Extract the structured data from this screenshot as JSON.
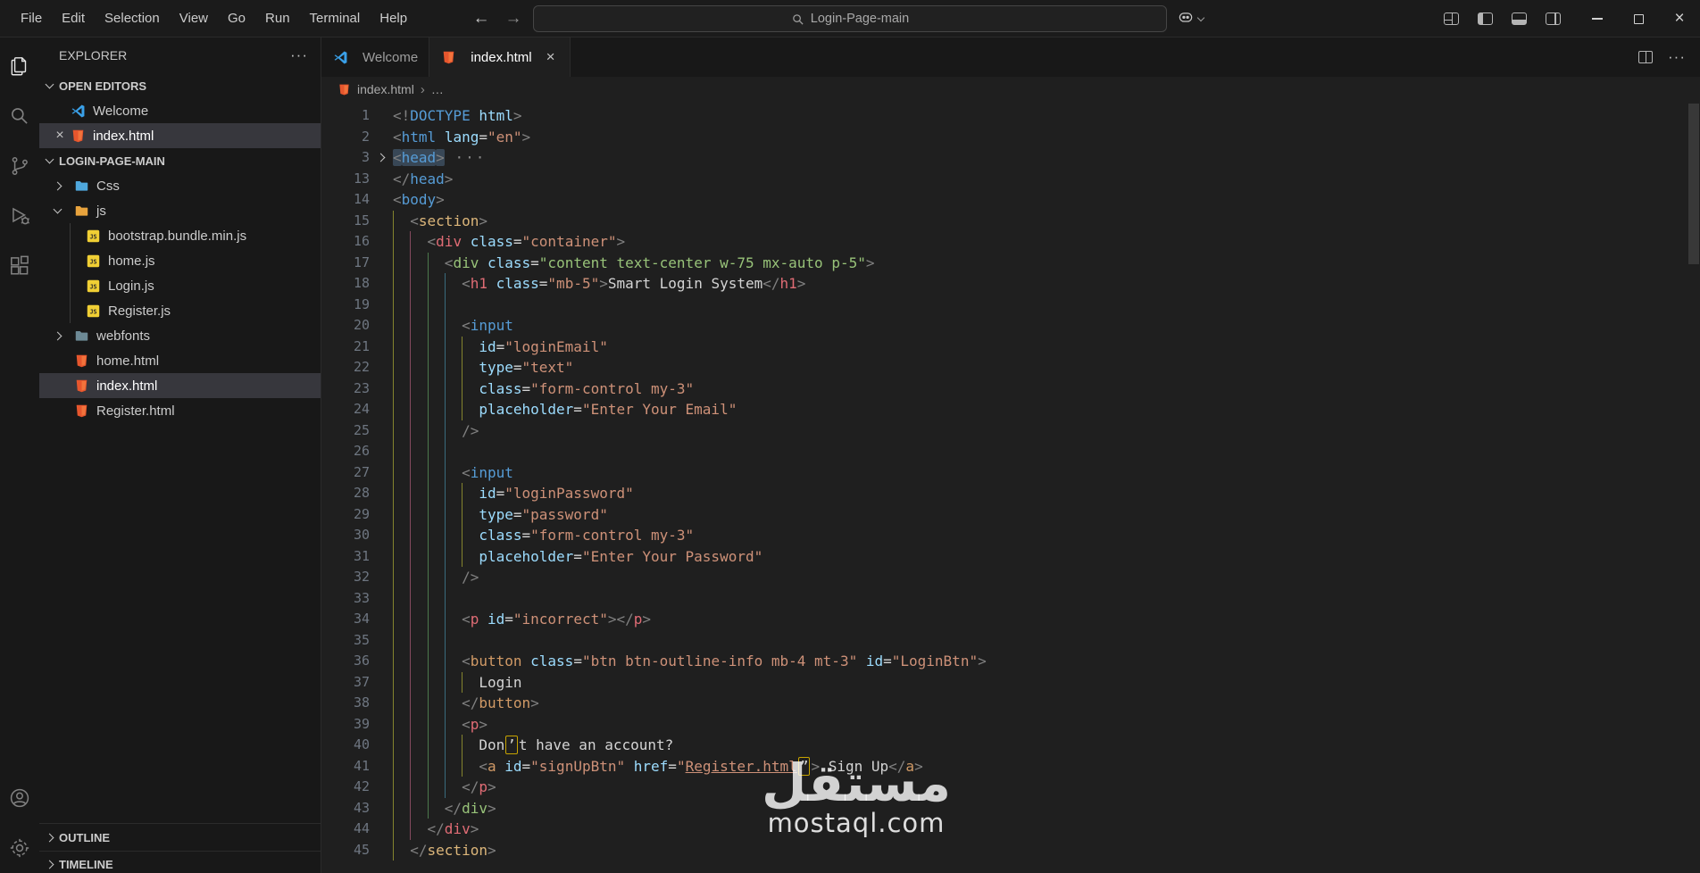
{
  "title_bar": {
    "menus": [
      "File",
      "Edit",
      "Selection",
      "View",
      "Go",
      "Run",
      "Terminal",
      "Help"
    ],
    "search": "Login-Page-main"
  },
  "activity_bar": {
    "items": [
      {
        "name": "explorer",
        "active": true
      },
      {
        "name": "search",
        "active": false
      },
      {
        "name": "source-control",
        "active": false
      },
      {
        "name": "run-debug",
        "active": false
      },
      {
        "name": "extensions",
        "active": false
      }
    ],
    "bottom": [
      {
        "name": "accounts",
        "active": false
      },
      {
        "name": "settings",
        "active": false
      }
    ]
  },
  "sidebar": {
    "title": "EXPLORER",
    "actions": "···",
    "sections": {
      "open_editors": {
        "label": "OPEN EDITORS"
      },
      "project": {
        "label": "LOGIN-PAGE-MAIN"
      },
      "outline": {
        "label": "OUTLINE"
      },
      "timeline": {
        "label": "TIMELINE"
      }
    },
    "open_editors_items": [
      {
        "name": "Welcome",
        "icon": "vscode",
        "selected": false,
        "closable": false
      },
      {
        "name": "index.html",
        "icon": "html",
        "selected": true,
        "closable": true
      }
    ],
    "tree": [
      {
        "name": "Css",
        "icon": "folder",
        "folder_color": "#4fa8dd",
        "chevron": "right",
        "child": false
      },
      {
        "name": "js",
        "icon": "folder",
        "folder_color": "#e8a33d",
        "chevron": "down",
        "child": false
      },
      {
        "name": "bootstrap.bundle.min.js",
        "icon": "js",
        "child": true
      },
      {
        "name": "home.js",
        "icon": "js",
        "child": true
      },
      {
        "name": "Login.js",
        "icon": "js",
        "child": true
      },
      {
        "name": "Register.js",
        "icon": "js",
        "child": true
      },
      {
        "name": "webfonts",
        "icon": "folder",
        "folder_color": "#6d8a96",
        "chevron": "right",
        "child": false
      },
      {
        "name": "home.html",
        "icon": "html",
        "child": false
      },
      {
        "name": "index.html",
        "icon": "html",
        "child": false,
        "selected": true
      },
      {
        "name": "Register.html",
        "icon": "html",
        "child": false
      }
    ]
  },
  "editor": {
    "tabs": [
      {
        "label": "Welcome",
        "icon": "vscode",
        "active": false,
        "closable": false
      },
      {
        "label": "index.html",
        "icon": "html",
        "active": true,
        "closable": true
      }
    ],
    "breadcrumb": {
      "file": "index.html",
      "more": "…"
    },
    "colors": {
      "p": "#808080",
      "tb": "#569cd6",
      "ty": "#dcb67a",
      "tr": "#e06c75",
      "tg": "#98c379",
      "to": "#d19a66",
      "at": "#9cdcfe",
      "s": "#ce9178",
      "sg": "#98c379",
      "tx": "#d4d4d4",
      "d": "#d4d4d4",
      "fold": "#8a8a8a",
      "box": "#d4d4d4",
      "slink": "#ce9178"
    },
    "guide_colors": [
      "rgba(255,255,64,0.45)",
      "rgba(255,127,171,0.45)",
      "rgba(130,230,130,0.45)",
      "rgba(90,200,240,0.45)"
    ],
    "code": {
      "lines": [
        {
          "n": 1,
          "g": 0,
          "t": [
            [
              "<!",
              "p"
            ],
            [
              "DOCTYPE",
              "tb"
            ],
            [
              " ",
              "d"
            ],
            [
              "html",
              "at"
            ],
            [
              ">",
              "p"
            ]
          ]
        },
        {
          "n": 2,
          "g": 0,
          "t": [
            [
              "<",
              "p"
            ],
            [
              "html",
              "tb"
            ],
            [
              " ",
              "d"
            ],
            [
              "lang",
              "at"
            ],
            [
              "=",
              "d"
            ],
            [
              "\"en\"",
              "s"
            ],
            [
              ">",
              "p"
            ]
          ]
        },
        {
          "n": 3,
          "g": 0,
          "fold": true,
          "t": [
            [
              "<",
              "p",
              "sel"
            ],
            [
              "head",
              "tb",
              "sel"
            ],
            [
              ">",
              "p",
              "sel"
            ],
            [
              " ",
              "d"
            ],
            [
              "···",
              "fold"
            ]
          ]
        },
        {
          "n": 13,
          "g": 0,
          "t": [
            [
              "</",
              "p"
            ],
            [
              "head",
              "tb"
            ],
            [
              ">",
              "p"
            ]
          ]
        },
        {
          "n": 14,
          "g": 0,
          "t": [
            [
              "<",
              "p"
            ],
            [
              "body",
              "tb"
            ],
            [
              ">",
              "p"
            ]
          ]
        },
        {
          "n": 15,
          "g": 1,
          "t": [
            [
              "<",
              "p"
            ],
            [
              "section",
              "ty"
            ],
            [
              ">",
              "p"
            ]
          ]
        },
        {
          "n": 16,
          "g": 2,
          "t": [
            [
              "<",
              "p"
            ],
            [
              "div",
              "tr"
            ],
            [
              " ",
              "d"
            ],
            [
              "class",
              "at"
            ],
            [
              "=",
              "d"
            ],
            [
              "\"container\"",
              "s"
            ],
            [
              ">",
              "p"
            ]
          ]
        },
        {
          "n": 17,
          "g": 3,
          "t": [
            [
              "<",
              "p"
            ],
            [
              "div",
              "tg"
            ],
            [
              " ",
              "d"
            ],
            [
              "class",
              "at"
            ],
            [
              "=",
              "d"
            ],
            [
              "\"content text-center w-75 mx-auto p-5\"",
              "sg"
            ],
            [
              ">",
              "p"
            ]
          ]
        },
        {
          "n": 18,
          "g": 4,
          "t": [
            [
              "<",
              "p"
            ],
            [
              "h1",
              "tr"
            ],
            [
              " ",
              "d"
            ],
            [
              "class",
              "at"
            ],
            [
              "=",
              "d"
            ],
            [
              "\"mb-5\"",
              "s"
            ],
            [
              ">",
              "p"
            ],
            [
              "Smart Login System",
              "tx"
            ],
            [
              "</",
              "p"
            ],
            [
              "h1",
              "tr"
            ],
            [
              ">",
              "p"
            ]
          ]
        },
        {
          "n": 19,
          "g": 4,
          "t": []
        },
        {
          "n": 20,
          "g": 4,
          "t": [
            [
              "<",
              "p"
            ],
            [
              "input",
              "tb"
            ]
          ]
        },
        {
          "n": 21,
          "g": 5,
          "t": [
            [
              "id",
              "at"
            ],
            [
              "=",
              "d"
            ],
            [
              "\"loginEmail\"",
              "s"
            ]
          ]
        },
        {
          "n": 22,
          "g": 5,
          "t": [
            [
              "type",
              "at"
            ],
            [
              "=",
              "d"
            ],
            [
              "\"text\"",
              "s"
            ]
          ]
        },
        {
          "n": 23,
          "g": 5,
          "t": [
            [
              "class",
              "at"
            ],
            [
              "=",
              "d"
            ],
            [
              "\"form-control my-3\"",
              "s"
            ]
          ]
        },
        {
          "n": 24,
          "g": 5,
          "t": [
            [
              "placeholder",
              "at"
            ],
            [
              "=",
              "d"
            ],
            [
              "\"Enter Your Email\"",
              "s"
            ]
          ]
        },
        {
          "n": 25,
          "g": 4,
          "t": [
            [
              "/>",
              "p"
            ]
          ]
        },
        {
          "n": 26,
          "g": 4,
          "t": []
        },
        {
          "n": 27,
          "g": 4,
          "t": [
            [
              "<",
              "p"
            ],
            [
              "input",
              "tb"
            ]
          ]
        },
        {
          "n": 28,
          "g": 5,
          "t": [
            [
              "id",
              "at"
            ],
            [
              "=",
              "d"
            ],
            [
              "\"loginPassword\"",
              "s"
            ]
          ]
        },
        {
          "n": 29,
          "g": 5,
          "t": [
            [
              "type",
              "at"
            ],
            [
              "=",
              "d"
            ],
            [
              "\"password\"",
              "s"
            ]
          ]
        },
        {
          "n": 30,
          "g": 5,
          "t": [
            [
              "class",
              "at"
            ],
            [
              "=",
              "d"
            ],
            [
              "\"form-control my-3\"",
              "s"
            ]
          ]
        },
        {
          "n": 31,
          "g": 5,
          "t": [
            [
              "placeholder",
              "at"
            ],
            [
              "=",
              "d"
            ],
            [
              "\"Enter Your Password\"",
              "s"
            ]
          ]
        },
        {
          "n": 32,
          "g": 4,
          "t": [
            [
              "/>",
              "p"
            ]
          ]
        },
        {
          "n": 33,
          "g": 4,
          "t": []
        },
        {
          "n": 34,
          "g": 4,
          "t": [
            [
              "<",
              "p"
            ],
            [
              "p",
              "tr"
            ],
            [
              " ",
              "d"
            ],
            [
              "id",
              "at"
            ],
            [
              "=",
              "d"
            ],
            [
              "\"incorrect\"",
              "s"
            ],
            [
              "></",
              "p"
            ],
            [
              "p",
              "tr"
            ],
            [
              ">",
              "p"
            ]
          ]
        },
        {
          "n": 35,
          "g": 4,
          "t": []
        },
        {
          "n": 36,
          "g": 4,
          "t": [
            [
              "<",
              "p"
            ],
            [
              "button",
              "to"
            ],
            [
              " ",
              "d"
            ],
            [
              "class",
              "at"
            ],
            [
              "=",
              "d"
            ],
            [
              "\"btn btn-outline-info mb-4 mt-3\"",
              "s"
            ],
            [
              " ",
              "d"
            ],
            [
              "id",
              "at"
            ],
            [
              "=",
              "d"
            ],
            [
              "\"LoginBtn\"",
              "s"
            ],
            [
              ">",
              "p"
            ]
          ]
        },
        {
          "n": 37,
          "g": 5,
          "t": [
            [
              "Login",
              "tx"
            ]
          ]
        },
        {
          "n": 38,
          "g": 4,
          "t": [
            [
              "</",
              "p"
            ],
            [
              "button",
              "to"
            ],
            [
              ">",
              "p"
            ]
          ]
        },
        {
          "n": 39,
          "g": 4,
          "t": [
            [
              "<",
              "p"
            ],
            [
              "p",
              "tr"
            ],
            [
              ">",
              "p"
            ]
          ]
        },
        {
          "n": 40,
          "g": 5,
          "t": [
            [
              "Don",
              "tx"
            ],
            [
              "’",
              "box"
            ],
            [
              "t have an account?",
              "tx"
            ]
          ]
        },
        {
          "n": 41,
          "g": 5,
          "t": [
            [
              "<",
              "p"
            ],
            [
              "a",
              "to"
            ],
            [
              " ",
              "d"
            ],
            [
              "id",
              "at"
            ],
            [
              "=",
              "d"
            ],
            [
              "\"signUpBtn\"",
              "s"
            ],
            [
              " ",
              "d"
            ],
            [
              "href",
              "at"
            ],
            [
              "=",
              "d"
            ],
            [
              "\"",
              "s"
            ],
            [
              "Register.html",
              "slink"
            ],
            [
              "”",
              "box"
            ],
            [
              ">",
              "p"
            ],
            [
              " Sign Up",
              "tx"
            ],
            [
              "</",
              "p"
            ],
            [
              "a",
              "to"
            ],
            [
              ">",
              "p"
            ]
          ]
        },
        {
          "n": 42,
          "g": 4,
          "t": [
            [
              "</",
              "p"
            ],
            [
              "p",
              "tr"
            ],
            [
              ">",
              "p"
            ]
          ]
        },
        {
          "n": 43,
          "g": 3,
          "t": [
            [
              "</",
              "p"
            ],
            [
              "div",
              "tg"
            ],
            [
              ">",
              "p"
            ]
          ]
        },
        {
          "n": 44,
          "g": 2,
          "t": [
            [
              "</",
              "p"
            ],
            [
              "div",
              "tr"
            ],
            [
              ">",
              "p"
            ]
          ]
        },
        {
          "n": 45,
          "g": 1,
          "t": [
            [
              "</",
              "p"
            ],
            [
              "section",
              "ty"
            ],
            [
              ">",
              "p"
            ]
          ]
        }
      ]
    }
  },
  "watermark": {
    "line1": "مستقل",
    "line2": "mostaql.com"
  }
}
